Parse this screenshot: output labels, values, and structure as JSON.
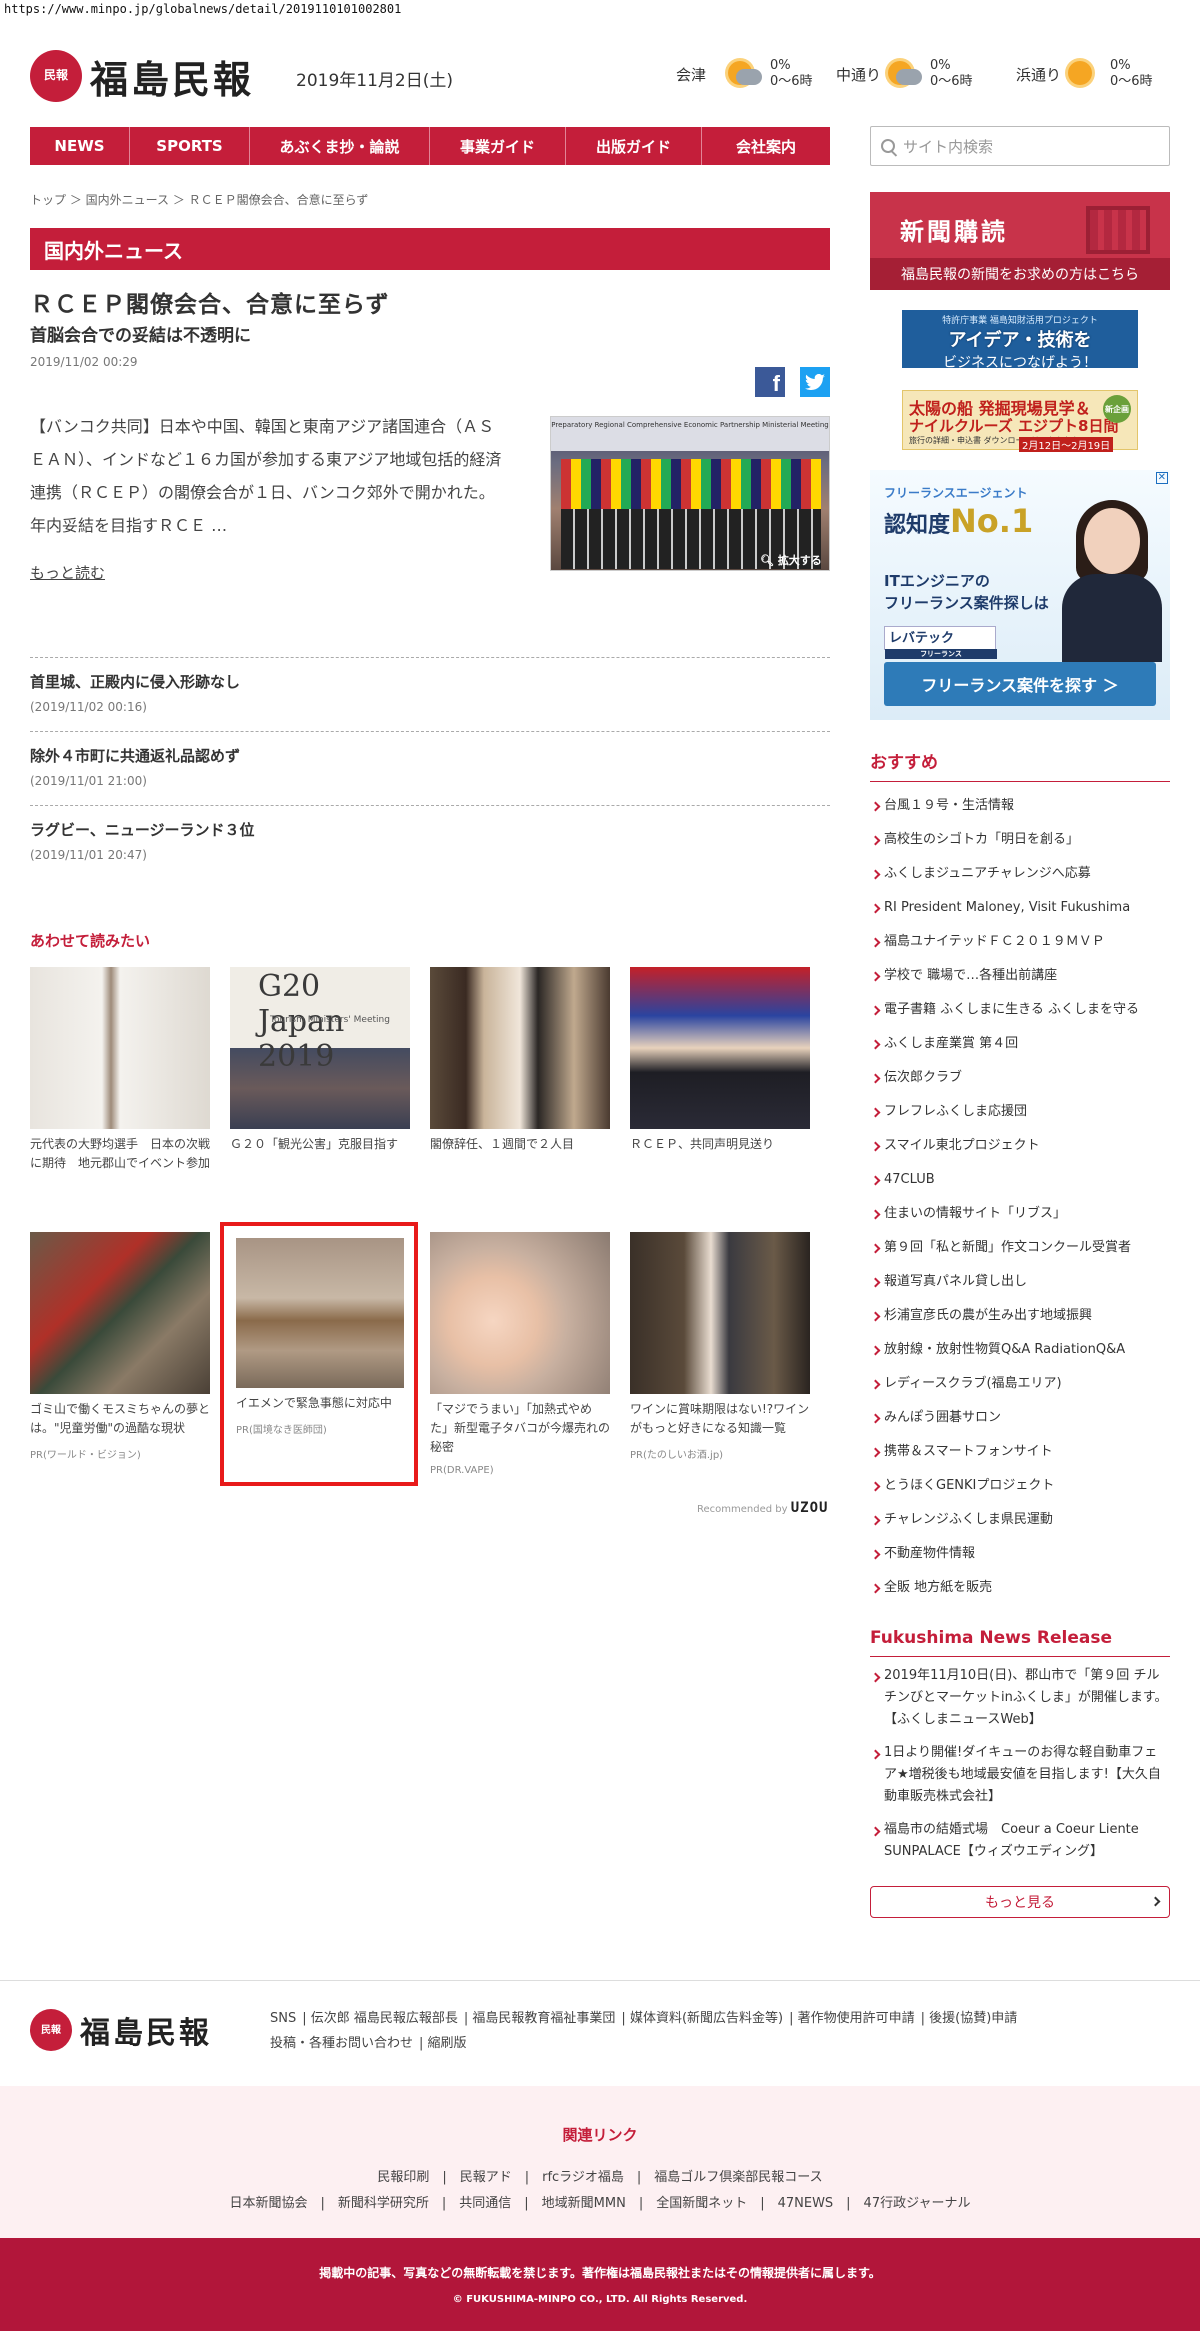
{
  "url": "https://www.minpo.jp/globalnews/detail/2019110101002801",
  "brand": {
    "badge": "民報",
    "name": "福島民報",
    "date": "2019年11月2日(土)",
    "accent": "#c41e3a"
  },
  "weather": [
    {
      "city": "会津",
      "pct": "0%",
      "time": "0〜6時",
      "icon": "cloud-sun-icon"
    },
    {
      "city": "中通り",
      "pct": "0%",
      "time": "0〜6時",
      "icon": "cloud-sun-icon"
    },
    {
      "city": "浜通り",
      "pct": "0%",
      "time": "0〜6時",
      "icon": "sun-icon"
    }
  ],
  "nav": [
    "NEWS",
    "SPORTS",
    "あぶくま抄・論説",
    "事業ガイド",
    "出版ガイド",
    "会社案内"
  ],
  "search": {
    "placeholder": "サイト内検索"
  },
  "breadcrumb": "トップ ＞ 国内外ニュース ＞ ＲＣＥＰ閣僚会合、合意に至らず",
  "section": "国内外ニュース",
  "article": {
    "title": "ＲＣＥＰ閣僚会合、合意に至らず",
    "subtitle": "首脳会合での妥結は不透明に",
    "timestamp": "2019/11/02 00:29",
    "lead": "【バンコク共同】日本や中国、韓国と東南アジア諸国連合（ＡＳＥＡＮ）、インドなど１６カ国が参加する東アジア地域包括的経済連携（ＲＣＥＰ）の閣僚会合が１日、バンコク郊外で開かれた。年内妥結を目指すＲＣＥ …",
    "photo_banner": "Preparatory Regional Comprehensive Economic Partnership Ministerial Meeting",
    "zoom": "拡大する",
    "more": "もっと読む"
  },
  "related": [
    {
      "title": "首里城、正殿内に侵入形跡なし",
      "date": "(2019/11/02 00:16)"
    },
    {
      "title": "除外４市町に共通返礼品認めず",
      "date": "(2019/11/01 21:00)"
    },
    {
      "title": "ラグビー、ニュージーランド３位",
      "date": "(2019/11/01 20:47)"
    }
  ],
  "read_together": {
    "heading": "あわせて読みたい",
    "cards": [
      {
        "caption": "元代表の大野均選手　日本の次戦に期待　地元郡山でイベント参加",
        "pr": ""
      },
      {
        "caption": "Ｇ２０「観光公害」克服目指す",
        "pr": ""
      },
      {
        "caption": "閣僚辞任、１週間で２人目",
        "pr": ""
      },
      {
        "caption": "ＲＣＥＰ、共同声明見送り",
        "pr": ""
      },
      {
        "caption": "ゴミ山で働くモスミちゃんの夢とは。\"児童労働\"の過酷な現状",
        "pr": "PR(ワールド・ビジョン)"
      },
      {
        "caption": "イエメンで緊急事態に対応中",
        "pr": "PR(国境なき医師団)"
      },
      {
        "caption": "「マジでうまい」「加熱式やめた」新型電子タバコが今爆売れの秘密",
        "pr": "PR(DR.VAPE)"
      },
      {
        "caption": "ワインに賞味期限はない!?ワインがもっと好きになる知識一覧",
        "pr": "PR(たのしいお酒.jp)"
      }
    ],
    "g20_sign": "G20 Japan 2019",
    "g20_sub": "Tourism Ministers' Meeting",
    "recommended_by": "Recommended by",
    "recommended_brand": "UZOU"
  },
  "sidebar": {
    "subscribe": {
      "title": "新聞購読",
      "subtitle": "福島民報の新聞をお求めの方はこちら"
    },
    "ad1": {
      "a": "特許庁事業 福島知財活用プロジェクト",
      "b": "アイデア・技術を",
      "c": "ビジネスにつなげよう！"
    },
    "ad2": {
      "a": "太陽の船 発掘現場見学＆",
      "b": "ナイルクルーズ エジプト8日間",
      "c": "旅行の詳細・申込書 ダウンロードはこちらから",
      "d": "2月12日〜2月19日",
      "badge": "新企画"
    },
    "ad3": {
      "a": "フリーランスエージェント",
      "b1": "認知度",
      "b2": "No.1",
      "c1": "ITエンジニアの",
      "c2": "フリーランス案件探しは",
      "d": "レバテック",
      "d2": "フリーランス",
      "e": "フリーランス案件を探す ＞",
      "x": "✕"
    },
    "recommend_heading": "おすすめ",
    "recommend": [
      "台風１９号・生活情報",
      "高校生のシゴトカ「明日を創る」",
      "ふくしまジュニアチャレンジへ応募",
      "RI President Maloney, Visit Fukushima",
      "福島ユナイテッドＦＣ２０１９ＭＶＰ",
      "学校で 職場で…各種出前講座",
      "電子書籍 ふくしまに生きる ふくしまを守る",
      "ふくしま産業賞 第４回",
      "伝次郎クラブ",
      "フレフレふくしま応援団",
      "スマイル東北プロジェクト",
      "47CLUB",
      "住まいの情報サイト「リブス」",
      "第９回「私と新聞」作文コンクール受賞者",
      "報道写真パネル貸し出し",
      "杉浦宣彦氏の農が生み出す地域振興",
      "放射線・放射性物質Q&A RadiationQ&A",
      "レディースクラブ(福島エリア)",
      "みんぽう囲碁サロン",
      "携帯＆スマートフォンサイト",
      "とうほくGENKIプロジェクト",
      "チャレンジふくしま県民運動",
      "不動産物件情報",
      "全販 地方紙を販売"
    ],
    "news_release_heading": "Fukushima News Release",
    "news_release": [
      "2019年11月10日(日)、郡山市で「第９回 チルチンびとマーケットinふくしま」が開催します。【ふくしまニュースWeb】",
      "1日より開催!ダイキューのお得な軽自動車フェア★増税後も地域最安値を目指します!【大久自動車販売株式会社】",
      "福島市の結婚式場　Coeur a Coeur Liente SUNPALACE【ウィズウエディング】"
    ],
    "more": "もっと見る"
  },
  "footer": {
    "links": [
      "SNS",
      "伝次郎 福島民報広報部長",
      "福島民報教育福祉事業団",
      "媒体資料(新聞広告料金等)",
      "著作物使用許可申請",
      "後援(協賛)申請",
      "投稿・各種お問い合わせ",
      "縮刷版"
    ],
    "related_heading": "関連リンク",
    "related_row1": "民報印刷　|　民報アド　|　rfcラジオ福島　|　福島ゴルフ倶楽部民報コース",
    "related_row2": "日本新聞協会　|　新聞科学研究所　|　共同通信　|　地域新聞MMN　|　全国新聞ネット　|　47NEWS　|　47行政ジャーナル",
    "notice": "掲載中の記事、写真などの無断転載を禁じます。著作権は福島民報社またはその情報提供者に属します。",
    "copyright": "© FUKUSHIMA-MINPO CO., LTD. All Rights Reserved."
  }
}
